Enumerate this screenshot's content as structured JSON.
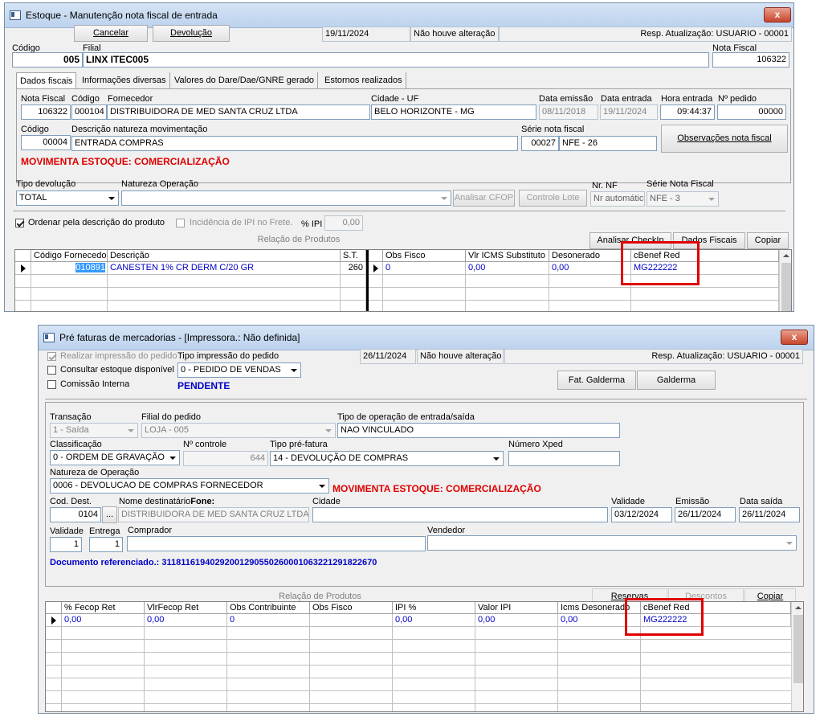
{
  "win1": {
    "title": "Estoque - Manutenção nota fiscal de entrada",
    "close": "x",
    "cancel_label": "Cancelar",
    "return_label": "Devolução",
    "date": "19/11/2024",
    "status": "Não houve alteração",
    "resp": "Resp. Atualização: USUARIO - 00001",
    "codigo_label": "Código",
    "codigo_value": "005",
    "filial_label": "Filial",
    "filial_value": "LINX ITEC005",
    "nf_label": "Nota Fiscal",
    "nf_value": "106322",
    "tabs": [
      "Dados fiscais",
      "Informações diversas",
      "Valores do Dare/Dae/GNRE gerado",
      "Estornos realizados"
    ],
    "nota_fiscal_label": "Nota Fiscal",
    "nota_fiscal_value": "106322",
    "cod_label": "Código",
    "cod_value": "000104",
    "fornecedor_label": "Fornecedor",
    "fornecedor_value": "DISTRIBUIDORA DE MED SANTA CRUZ LTDA",
    "cidade_label": "Cidade - UF",
    "cidade_value": "BELO HORIZONTE - MG",
    "data_emissao_label": "Data emissão",
    "data_emissao_value": "08/11/2018",
    "data_entrada_label": "Data entrada",
    "data_entrada_value": "19/11/2024",
    "hora_label": "Hora entrada",
    "hora_value": "09:44:37",
    "pedido_label": "Nº pedido",
    "pedido_value": "00000",
    "cod2_label": "Código",
    "cod2_value": "00004",
    "natureza_label": "Descrição natureza movimentação",
    "natureza_value": "ENTRADA COMPRAS",
    "serie_label": "Série nota fiscal",
    "serie_code": "00027",
    "serie_value": "NFE  -  26",
    "obs_btn": "Observações nota fiscal",
    "movimenta": "MOVIMENTA ESTOQUE: COMERCIALIZAÇÃO",
    "tipo_dev_label": "Tipo devolução",
    "tipo_dev_value": "TOTAL",
    "nat_op_label": "Natureza  Operação",
    "nat_op_value": "",
    "analisar_cfop": "Analisar CFOP",
    "controle_lote": "Controle Lote",
    "nr_nf_label": "Nr. NF",
    "nr_nf_value": "Nr automático",
    "serie_nf_label": "Série Nota Fiscal",
    "serie_nf_value": "NFE - 3",
    "ordenar_label": "Ordenar pela descrição do produto",
    "incidencia_label": "Incidência de IPI no Frete.",
    "ipi_label": "% IPI",
    "ipi_value": "0,00",
    "relacao_label": "Relação de Produtos",
    "analisar_checkin": "Analisar CheckIn",
    "dados_fiscais": "Dados  Fiscais",
    "copiar": "Copiar",
    "grid_left_headers": [
      "Código Fornecedor",
      "Descrição",
      "S.T."
    ],
    "grid_left_row": [
      "010891",
      "CANESTEN 1% CR DERM C/20 GR",
      "260"
    ],
    "grid_right_headers": [
      "Obs Fisco",
      "Vlr ICMS Substituto",
      "Desonerado",
      "cBenef Red"
    ],
    "grid_right_row": [
      "0",
      "0,00",
      "0,00",
      "MG222222"
    ]
  },
  "win2": {
    "title": "Pré faturas de mercadorias - [Impressora.: Não definida]",
    "close": "x",
    "realizar_label": "Realizar impressão do pedido",
    "tipo_imp_label": "Tipo impressão do pedido",
    "tipo_imp_value": "0 - PEDIDO DE VENDAS",
    "consultar_label": "Consultar estoque disponível",
    "comissao_label": "Comissão Interna",
    "pendente": "PENDENTE",
    "date": "26/11/2024",
    "status": "Não houve alteração",
    "resp": "Resp. Atualização: USUARIO - 00001",
    "fat_galderma": "Fat. Galderma",
    "galderma": "Galderma",
    "transacao_label": "Transação",
    "transacao_value": "1 - Saída",
    "filial_label": "Filial do pedido",
    "filial_value": "LOJA - 005",
    "tipo_op_label": "Tipo de operação de entrada/saída",
    "tipo_op_value": "NAO VINCULADO",
    "classificacao_label": "Classificação",
    "classificacao_value": "0 - ORDEM DE GRAVAÇÃO",
    "controle_label": "Nº controle",
    "controle_value": "644",
    "tipo_pre_label": "Tipo pré-fatura",
    "tipo_pre_value": "14 - DEVOLUÇÃO DE COMPRAS",
    "xped_label": "Número Xped",
    "xped_value": "",
    "natureza_label": "Natureza de Operação",
    "natureza_value": "0006 - DEVOLUCAO DE COMPRAS FORNECEDOR",
    "movimenta": "MOVIMENTA ESTOQUE: COMERCIALIZAÇÃO",
    "cod_dest_label": "Cod. Dest.",
    "cod_dest_value": "0104",
    "lookup": "...",
    "nome_dest_label": "Nome destinatário",
    "fone_label": "Fone:",
    "nome_dest_value": "DISTRIBUIDORA DE MED SANTA CRUZ LTDA",
    "cidade_label": "Cidade",
    "cidade_value": "",
    "validade_label": "Validade",
    "validade_value": "03/12/2024",
    "emissao_label": "Emissão",
    "emissao_value": "26/11/2024",
    "data_saida_label": "Data saída",
    "data_saida_value": "26/11/2024",
    "validade2_label": "Validade",
    "validade2_value": "1",
    "entrega_label": "Entrega",
    "entrega_value": "1",
    "comprador_label": "Comprador",
    "vendedor_label": "Vendedor",
    "doc_ref": "Documento referenciado.: 31181161940292001290550260001063221291822670",
    "relacao_label": "Relação de Produtos",
    "reservas": "Reservas",
    "descontos": "Descontos",
    "copiar": "Copiar",
    "grid_headers": [
      "% Fecop Ret",
      "VlrFecop Ret",
      "Obs Contribuinte",
      "Obs Fisco",
      "IPI %",
      "Valor IPI",
      "Icms Desonerado",
      "cBenef Red"
    ],
    "grid_row": [
      "0,00",
      "0,00",
      "0",
      "",
      "0,00",
      "0,00",
      "0,00",
      "MG222222"
    ]
  },
  "colors": {
    "highlight": "#e00000",
    "value_blue": "#0000c8",
    "selection": "#3399ff"
  }
}
